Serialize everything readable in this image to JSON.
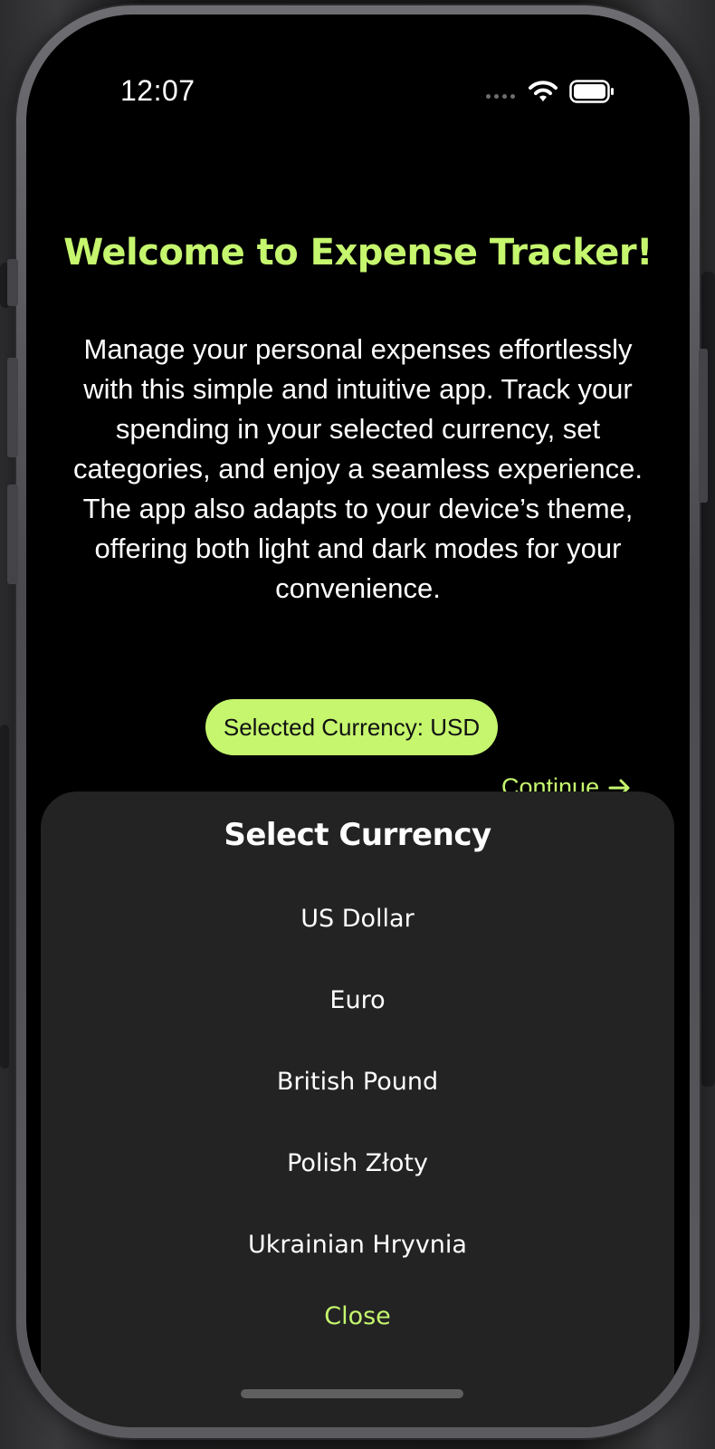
{
  "status_bar": {
    "time": "12:07"
  },
  "welcome": {
    "title": "Welcome to Expense Tracker!",
    "description": "Manage your personal expenses effortlessly with this simple and intuitive app. Track your spending in your selected currency, set categories, and enjoy a seamless experience. The app also adapts to your device’s theme, offering both light and dark modes for your convenience.",
    "selected_currency_label": "Selected Currency: USD",
    "continue_label": "Continue"
  },
  "currency_sheet": {
    "title": "Select Currency",
    "options": [
      "US Dollar",
      "Euro",
      "British Pound",
      "Polish Złoty",
      "Ukrainian Hryvnia"
    ],
    "close_label": "Close"
  },
  "colors": {
    "accent": "#c5f66e",
    "background": "#000000",
    "sheet_background": "#232323",
    "text": "#ffffff"
  },
  "icons": {
    "continue": "arrow-right-icon",
    "status": [
      "cellular-signal-icon",
      "wifi-icon",
      "battery-icon"
    ]
  }
}
